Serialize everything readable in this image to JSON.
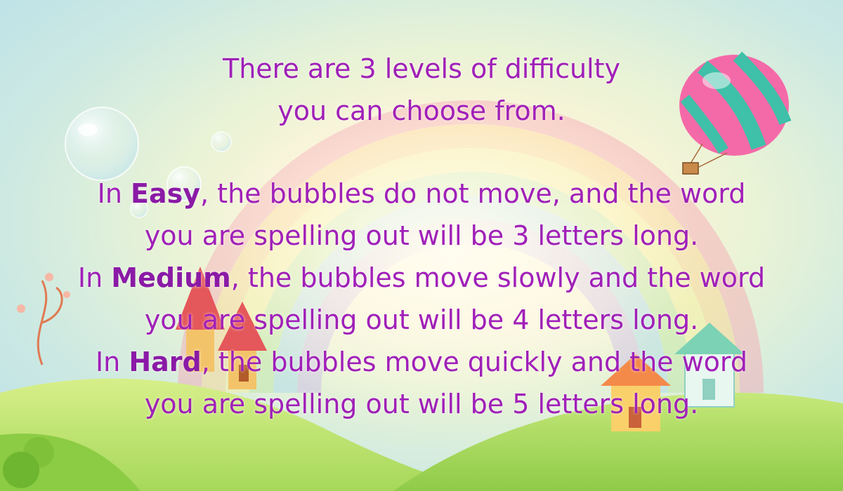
{
  "intro": {
    "line1": "There are 3 levels of difficulty",
    "line2": "you can choose from."
  },
  "levels": {
    "easy": {
      "prefix": "In ",
      "name": "Easy",
      "rest": ", the bubbles do not move, and the word",
      "line2": "you are spelling out will be 3 letters long."
    },
    "medium": {
      "prefix": "In ",
      "name": "Medium",
      "rest": ", the bubbles move slowly and the word",
      "line2": "you are spelling out will be 4 letters long."
    },
    "hard": {
      "prefix": "In ",
      "name": "Hard",
      "rest": ", the bubbles move quickly and the word",
      "line2": "you are spelling out will be 5 letters long."
    }
  },
  "colors": {
    "text": "#a020b8",
    "sky": "#b9e0ea",
    "grass": "#a6d85a"
  },
  "decorations": [
    "rainbow",
    "hot-air-balloon",
    "soap-bubble",
    "bubble-small",
    "mushroom-house",
    "cottage",
    "curly-tree",
    "grass-hills"
  ]
}
